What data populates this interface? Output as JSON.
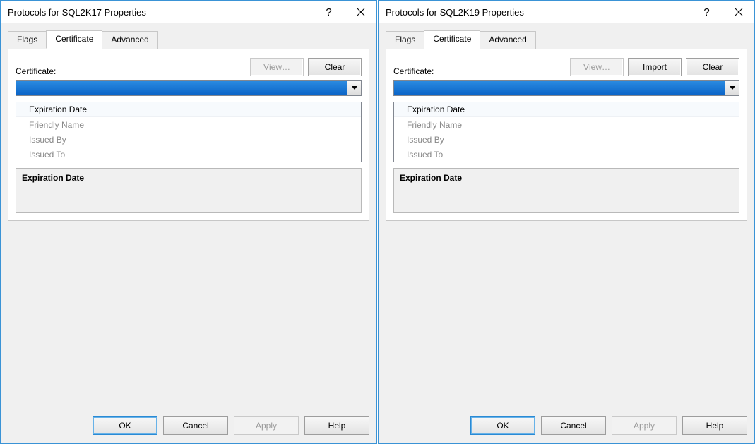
{
  "left": {
    "title": "Protocols for SQL2K17 Properties",
    "tabs": {
      "flags": "Flags",
      "certificate": "Certificate",
      "advanced": "Advanced"
    },
    "active_tab": "certificate",
    "cert_label": "Certificate:",
    "buttons": {
      "view": "View…",
      "clear": "Clear"
    },
    "combo_value": "",
    "grid_rows": [
      "Expiration Date",
      "Friendly Name",
      "Issued By",
      "Issued To"
    ],
    "desc_title": "Expiration Date",
    "bottom": {
      "ok": "OK",
      "cancel": "Cancel",
      "apply": "Apply",
      "help": "Help"
    }
  },
  "right": {
    "title": "Protocols for SQL2K19 Properties",
    "tabs": {
      "flags": "Flags",
      "certificate": "Certificate",
      "advanced": "Advanced"
    },
    "active_tab": "certificate",
    "cert_label": "Certificate:",
    "buttons": {
      "view": "View…",
      "import": "Import",
      "clear": "Clear"
    },
    "combo_value": "",
    "grid_rows": [
      "Expiration Date",
      "Friendly Name",
      "Issued By",
      "Issued To"
    ],
    "desc_title": "Expiration Date",
    "bottom": {
      "ok": "OK",
      "cancel": "Cancel",
      "apply": "Apply",
      "help": "Help"
    }
  }
}
